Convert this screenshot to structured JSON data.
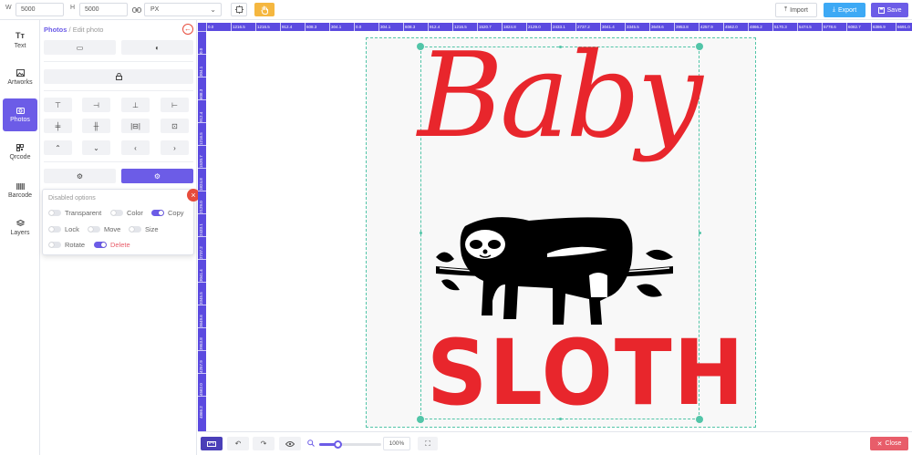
{
  "toolbar": {
    "width_label": "W",
    "width_value": "5000",
    "height_label": "H",
    "height_value": "5000",
    "unit": "PX",
    "import_label": "Import",
    "export_label": "Export",
    "save_label": "Save"
  },
  "rail": {
    "items": [
      {
        "label": "Text",
        "icon": "text-icon"
      },
      {
        "label": "Artworks",
        "icon": "image-icon"
      },
      {
        "label": "Photos",
        "icon": "camera-icon",
        "active": true
      },
      {
        "label": "Qrcode",
        "icon": "qrcode-icon"
      },
      {
        "label": "Barcode",
        "icon": "barcode-icon"
      },
      {
        "label": "Layers",
        "icon": "layers-icon"
      }
    ]
  },
  "panel": {
    "breadcrumb_root": "Photos",
    "breadcrumb_sep": "/",
    "breadcrumb_page": "Edit photo"
  },
  "options": {
    "title": "Disabled options",
    "items": [
      {
        "label": "Transparent",
        "on": false
      },
      {
        "label": "Color",
        "on": false
      },
      {
        "label": "Copy",
        "on": true
      },
      {
        "label": "Lock",
        "on": false
      },
      {
        "label": "Move",
        "on": false
      },
      {
        "label": "Size",
        "on": false
      },
      {
        "label": "Rotate",
        "on": false
      },
      {
        "label": "Delete",
        "on": true
      }
    ]
  },
  "ruler": {
    "top": [
      "0.0",
      "1216.5",
      "1216.5",
      "912.4",
      "608.3",
      "304.1",
      "0.0",
      "304.1",
      "608.3",
      "912.4",
      "1216.5",
      "1520.7",
      "1824.8",
      "2129.0",
      "2433.1",
      "2737.2",
      "3041.4",
      "3345.5",
      "3649.6",
      "3953.8",
      "4257.9",
      "4562.0",
      "4866.2",
      "5170.3",
      "5474.5",
      "5778.6",
      "6082.7",
      "6386.9",
      "6691.0"
    ],
    "left": [
      "0.0",
      "304.1",
      "608.3",
      "912.4",
      "1216.5",
      "1520.7",
      "1824.8",
      "2129.0",
      "2433.1",
      "2737.2",
      "3041.4",
      "3345.5",
      "3649.6",
      "3953.8",
      "4257.9",
      "4562.0",
      "4866.2"
    ]
  },
  "artwork": {
    "line1": "Baby",
    "line2": "SLOTH",
    "accent_color": "#e8262c"
  },
  "bottom": {
    "zoom_label": "100%",
    "zoom_fraction": 0.3,
    "close_label": "Close"
  },
  "colors": {
    "primary": "#6c5ce7",
    "export": "#3da9f5",
    "warning": "#f5b740",
    "danger": "#e85d6a",
    "guide": "#52c5a8"
  }
}
